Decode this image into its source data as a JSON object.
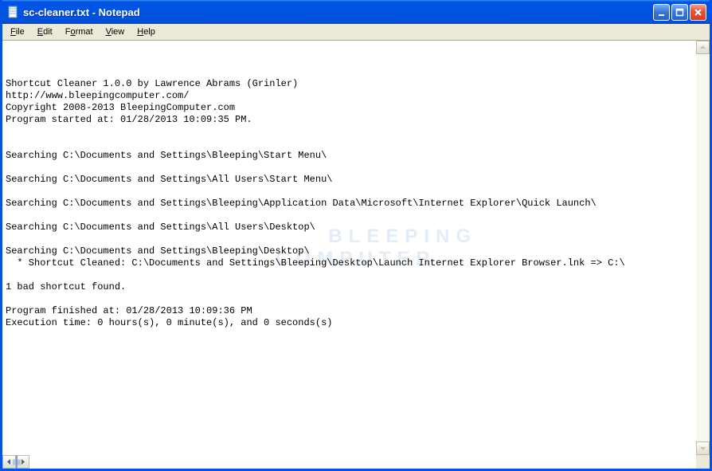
{
  "window": {
    "title": "sc-cleaner.txt - Notepad"
  },
  "menubar": {
    "items": [
      {
        "label": "File",
        "accelerator": "F"
      },
      {
        "label": "Edit",
        "accelerator": "E"
      },
      {
        "label": "Format",
        "accelerator": "o"
      },
      {
        "label": "View",
        "accelerator": "V"
      },
      {
        "label": "Help",
        "accelerator": "H"
      }
    ]
  },
  "content": {
    "lines": [
      "Shortcut Cleaner 1.0.0 by Lawrence Abrams (Grinler)",
      "http://www.bleepingcomputer.com/",
      "Copyright 2008-2013 BleepingComputer.com",
      "Program started at: 01/28/2013 10:09:35 PM.",
      "",
      "",
      "Searching C:\\Documents and Settings\\Bleeping\\Start Menu\\",
      "",
      "Searching C:\\Documents and Settings\\All Users\\Start Menu\\",
      "",
      "Searching C:\\Documents and Settings\\Bleeping\\Application Data\\Microsoft\\Internet Explorer\\Quick Launch\\",
      "",
      "Searching C:\\Documents and Settings\\All Users\\Desktop\\",
      "",
      "Searching C:\\Documents and Settings\\Bleeping\\Desktop\\",
      "  * Shortcut Cleaned: C:\\Documents and Settings\\Bleeping\\Desktop\\Launch Internet Explorer Browser.lnk => C:\\",
      "",
      "1 bad shortcut found.",
      "",
      "Program finished at: 01/28/2013 10:09:36 PM",
      "Execution time: 0 hours(s), 0 minute(s), and 0 seconds(s)"
    ]
  },
  "watermark": {
    "line1": "BLEEPING",
    "line2": "COMPUTER"
  }
}
